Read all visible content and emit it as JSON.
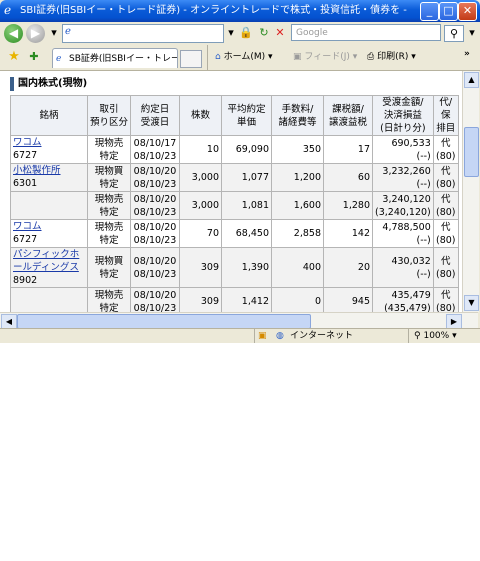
{
  "window": {
    "title": "SBI証券(旧SBIイー・トレード証券) - オンライントレードで株式・投資信託・債券を - - Win...",
    "minimize_glyph": "_",
    "maximize_glyph": "□",
    "close_glyph": "✕"
  },
  "toolbar": {
    "address_value": "",
    "search_placeholder": "Google",
    "tab_label": "SB証券(旧SBIイー・トレー...",
    "home_label": "ホーム(M)",
    "feed_label": "フィード(J)",
    "print_label": "印刷(R)"
  },
  "page": {
    "section_title": "国内株式(現物)",
    "columns": [
      "銘柄",
      "取引\n預り区分",
      "約定日\n受渡日",
      "株数",
      "平均約定\n単価",
      "手数料/\n諸経費等",
      "課税額/\n譲渡益税",
      "受渡金額/\n決済損益\n(日計り分)",
      "代/保\n排目"
    ],
    "rows": [
      {
        "name": "ワコム",
        "code": "6727",
        "type1": "現物売",
        "type2": "特定",
        "date1": "08/10/17",
        "date2": "08/10/23",
        "qty": "10",
        "price": "69,090",
        "fee": "350",
        "tax": "17",
        "amount": "690,533",
        "pl": "(--)",
        "dai": "代",
        "dai2": "(80)"
      },
      {
        "name": "小松製作所",
        "code": "6301",
        "type1": "現物買",
        "type2": "特定",
        "date1": "08/10/20",
        "date2": "08/10/23",
        "qty": "3,000",
        "price": "1,077",
        "fee": "1,200",
        "tax": "60",
        "amount": "3,232,260",
        "pl": "(--)",
        "dai": "代",
        "dai2": "(80)"
      },
      {
        "name": "",
        "code": "",
        "type1": "現物売",
        "type2": "特定",
        "date1": "08/10/20",
        "date2": "08/10/23",
        "qty": "3,000",
        "price": "1,081",
        "fee": "1,600",
        "tax": "1,280",
        "amount": "3,240,120",
        "pl": "(3,240,120)",
        "dai": "代",
        "dai2": "(80)"
      },
      {
        "name": "ワコム",
        "code": "6727",
        "type1": "現物売",
        "type2": "特定",
        "date1": "08/10/20",
        "date2": "08/10/23",
        "qty": "70",
        "price": "68,450",
        "fee": "2,858",
        "tax": "142",
        "amount": "4,788,500",
        "pl": "(--)",
        "dai": "代",
        "dai2": "(80)"
      },
      {
        "name": "パシフィックホールディングス",
        "code": "8902",
        "type1": "現物買",
        "type2": "特定",
        "date1": "08/10/20",
        "date2": "08/10/23",
        "qty": "309",
        "price": "1,390",
        "fee": "400",
        "tax": "20",
        "amount": "430,032",
        "pl": "(--)",
        "dai": "代",
        "dai2": "(80)"
      },
      {
        "name": "",
        "code": "",
        "type1": "現物売",
        "type2": "特定",
        "date1": "08/10/20",
        "date2": "08/10/23",
        "qty": "309",
        "price": "1,412",
        "fee": "0",
        "tax": "945",
        "amount": "435,479",
        "pl": "(435,479)",
        "dai": "代",
        "dai2": "(80)"
      }
    ]
  },
  "status": {
    "zone": "インターネット",
    "zoom": "100%"
  }
}
